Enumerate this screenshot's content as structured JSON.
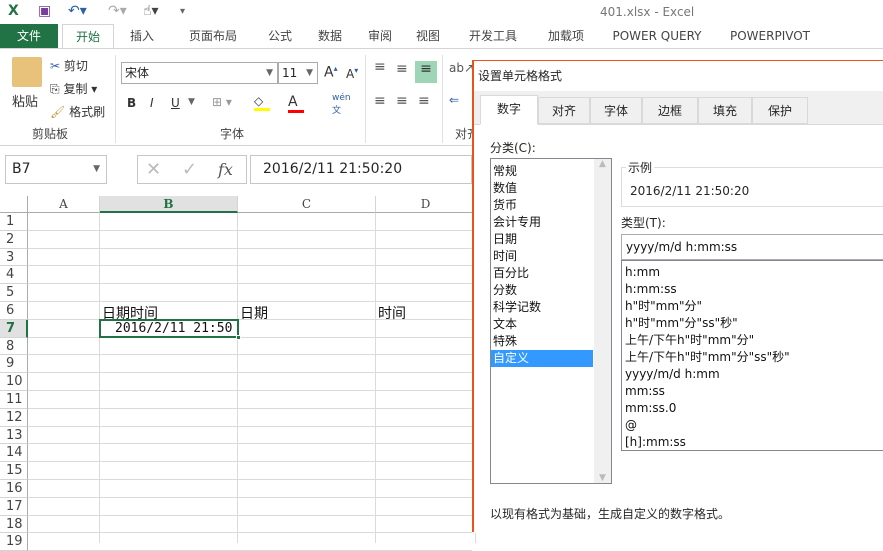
{
  "titlebar": {
    "title": "401.xlsx - Excel",
    "icons": [
      "excel-logo",
      "save-icon",
      "undo-icon",
      "redo-icon",
      "touch-mode-icon",
      "customize-icon"
    ]
  },
  "tabs": [
    "文件",
    "开始",
    "插入",
    "页面布局",
    "公式",
    "数据",
    "审阅",
    "视图",
    "开发工具",
    "加载项",
    "POWER QUERY",
    "POWERPIVOT"
  ],
  "ribbon": {
    "paste": "粘贴",
    "cut": "剪切",
    "copy": "复制",
    "format_painter": "格式刷",
    "clipboard_group": "剪贴板",
    "font_name": "宋体",
    "font_size": "11",
    "bold": "B",
    "italic": "I",
    "underline": "U",
    "font_color": "A",
    "phonetic": "wén",
    "font_group": "字体",
    "align_group": "对齐",
    "fill_color": "#ffff00",
    "font_color_value": "#ff0000"
  },
  "formula_bar": {
    "name_box": "B7",
    "cancel": "✕",
    "enter": "✓",
    "fx": "fx",
    "value": "2016/2/11  21:50:20"
  },
  "sheet": {
    "columns": [
      "A",
      "B",
      "C",
      "D"
    ],
    "rows": [
      "1",
      "2",
      "3",
      "4",
      "5",
      "6",
      "7",
      "8",
      "9",
      "10",
      "11",
      "12",
      "13",
      "14",
      "15",
      "16",
      "17",
      "18",
      "19"
    ],
    "cells": {
      "B6": "日期时间",
      "C6": "日期",
      "D6": "时间",
      "B7": "2016/2/11  21:50"
    },
    "selected": "B7"
  },
  "dialog": {
    "title": "设置单元格格式",
    "tabs": [
      "数字",
      "对齐",
      "字体",
      "边框",
      "填充",
      "保护"
    ],
    "category_label": "分类(C):",
    "categories": [
      "常规",
      "数值",
      "货币",
      "会计专用",
      "日期",
      "时间",
      "百分比",
      "分数",
      "科学记数",
      "文本",
      "特殊",
      "自定义"
    ],
    "selected_category": "自定义",
    "sample_label": "示例",
    "sample_value": "2016/2/11 21:50:20",
    "type_label": "类型(T):",
    "type_value": "yyyy/m/d h:mm:ss",
    "formats": [
      "h:mm",
      "h:mm:ss",
      "h\"时\"mm\"分\"",
      "h\"时\"mm\"分\"ss\"秒\"",
      "上午/下午h\"时\"mm\"分\"",
      "上午/下午h\"时\"mm\"分\"ss\"秒\"",
      "yyyy/m/d h:mm",
      "mm:ss",
      "mm:ss.0",
      "@",
      "[h]:mm:ss"
    ],
    "description": "以现有格式为基础，生成自定义的数字格式。"
  }
}
